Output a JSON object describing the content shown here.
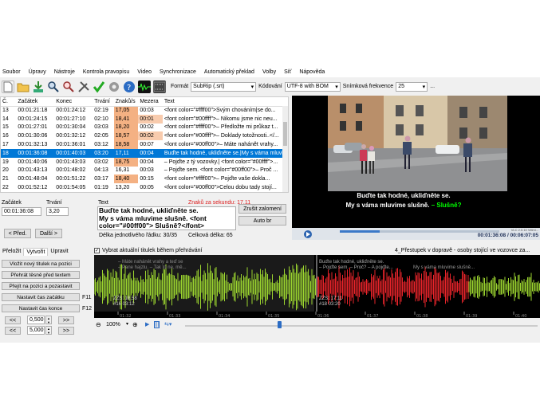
{
  "menu": [
    "Soubor",
    "Úpravy",
    "Nástroje",
    "Kontrola pravopisu",
    "Video",
    "Synchronizace",
    "Automatický překlad",
    "Volby",
    "Síť",
    "Nápověda"
  ],
  "toolbar": {
    "format_label": "Formát",
    "format_value": "SubRip (.srt)",
    "encoding_label": "Kódování",
    "encoding_value": "UTF-8 with BOM",
    "fps_label": "Snímková frekvence",
    "fps_value": "25",
    "more": "..."
  },
  "grid": {
    "headers": [
      "Č.",
      "Začátek",
      "Konec",
      "Trvání",
      "Znaků/s",
      "Mezera",
      "Text"
    ],
    "rows": [
      [
        "13",
        "00:01:21:18",
        "00:01:24:12",
        "02:19",
        "17,05",
        "00:03",
        "<font color=\"#ffff00\">Svým chováním|se do..."
      ],
      [
        "14",
        "00:01:24:15",
        "00:01:27:10",
        "02:10",
        "18,41",
        "00:01",
        "<font color=\"#00ffff\">– Nikomu jsme nic neu..."
      ],
      [
        "15",
        "00:01:27:01",
        "00:01:30:04",
        "03:03",
        "18,20",
        "00:02",
        "<font color=\"#ffff00\">– Předložte mi průkaz t..."
      ],
      [
        "16",
        "00:01:30:06",
        "00:01:32:12",
        "02:05",
        "18,57",
        "00:02",
        "<font color=\"#00ffff\">– Doklady totožnosti..</..."
      ],
      [
        "17",
        "00:01:32:13",
        "00:01:36:01",
        "03:12",
        "18,58",
        "00:07",
        "<font color=\"#00ff00\">– Máte nahánět vrahy..."
      ],
      [
        "18",
        "00:01:36:08",
        "00:01:40:03",
        "03:20",
        "17,11",
        "00:04",
        "Buďte tak hodné, ukliďněte se.|My s vámа mluvime..."
      ],
      [
        "19",
        "00:01:40:06",
        "00:01:43:03",
        "03:02",
        "18,75",
        "00:04",
        "– Pojďte z tý vozovky.| <font color=\"#00ffff\">..."
      ],
      [
        "20",
        "00:01:43:13",
        "00:01:48:02",
        "04:13",
        "16,31",
        "00:03",
        "– Pojďte sem. <font color=\"#00ff00\">– Proč ..."
      ],
      [
        "21",
        "00:01:48:04",
        "00:01:51:22",
        "03:17",
        "18,40",
        "00:15",
        "<font color=\"#ffff00\">– Pojďte vaše dokla..."
      ],
      [
        "22",
        "00:01:52:12",
        "00:01:54:05",
        "01:19",
        "13,20",
        "00:05",
        "<font color=\"#00ff00\">Celou dobu tady stojí..."
      ]
    ],
    "highlight": [
      [
        "17,05"
      ],
      [
        "18,41",
        "00:01"
      ],
      [
        "18,20"
      ],
      [
        "18,57",
        "00:02"
      ],
      [
        "18,58"
      ],
      [],
      [
        "18,75"
      ],
      [],
      [
        "18,40"
      ],
      []
    ]
  },
  "edit": {
    "start_label": "Začátek",
    "duration_label": "Trvání",
    "start_value": "00:01:36:08",
    "duration_value": "3,20",
    "text_label": "Text",
    "cps_info": "Znaků za sekundu: 17,11",
    "text_line1": "Buďte tak hodné, ukliďněte se.",
    "text_line2": "My s vámа mluvime slušně. <font",
    "text_line3": "color=\"#00ff00\"> Slušně?</font>",
    "line_length": "Délka jednotlivého řádku: 30/35",
    "total_length": "Celková délka: 65",
    "prev_btn": "< Před.",
    "next_btn": "Další >",
    "unbreak_btn": "Zrušit zalomení",
    "autobr_btn": "Auto br"
  },
  "video": {
    "sub_line1": "Buďte tak hodné, ukliďněte se.",
    "sub_line2a": "My s vámа mluvime slušně. ",
    "sub_line2b": "– Slušně?",
    "time": "00:01:36:08 / 00:06:07:05",
    "vlc": "VLC 2.0.10 Velmi..."
  },
  "bottom": {
    "tabs": [
      "Přeložit",
      "Vytvořit",
      "Upravit"
    ],
    "checkbox_label": "Vybrat aktuální titulek během přehrávání",
    "wave_title": "4_Přestupek v dopravě - osoby stojící ve vozovce za...",
    "buttons": [
      "Vložit nový titulek na pozici",
      "Přehrát těsně před textem",
      "Přejít na pozici a pozastavit",
      "Nastavit čas začátku",
      "Nastavit čas konce"
    ],
    "f11": "F11",
    "f12": "F12",
    "step1": "0,500",
    "step2": "5,000",
    "back": "<<",
    "fwd": ">>",
    "zoom": "100%",
    "wave_sub_left1": "– Máte nahánět vrahy a teď se",
    "wave_sub_left2": "– Pane hajzlu. – Tak to ne, mě...",
    "wave_sub_mid": "– Pojďte sem. – Proč? – A pojďte...",
    "wave_sub_right": "Buďte tak hodné, ukliďněte se.",
    "wave_sub_right2": "My s vámа mluvime slušně...",
    "wave_idx1": "#16  03:12",
    "wave_idx2": "#18  03:20",
    "wave_cps1": "ZZS: 18,58",
    "wave_cps2": "ZZS: 17,11",
    "ticks": [
      "01:32",
      "01:33",
      "01:34",
      "01:35",
      "01:36",
      "01:37",
      "01:38",
      "01:39",
      "01:40"
    ],
    "tick_small": "01:36"
  },
  "colors": {
    "selection": "#0078d7",
    "cps_high": "#f4b183",
    "wave_green": "#9bd42f",
    "wave_red": "#e8242a",
    "wave_bg": "#000000"
  }
}
